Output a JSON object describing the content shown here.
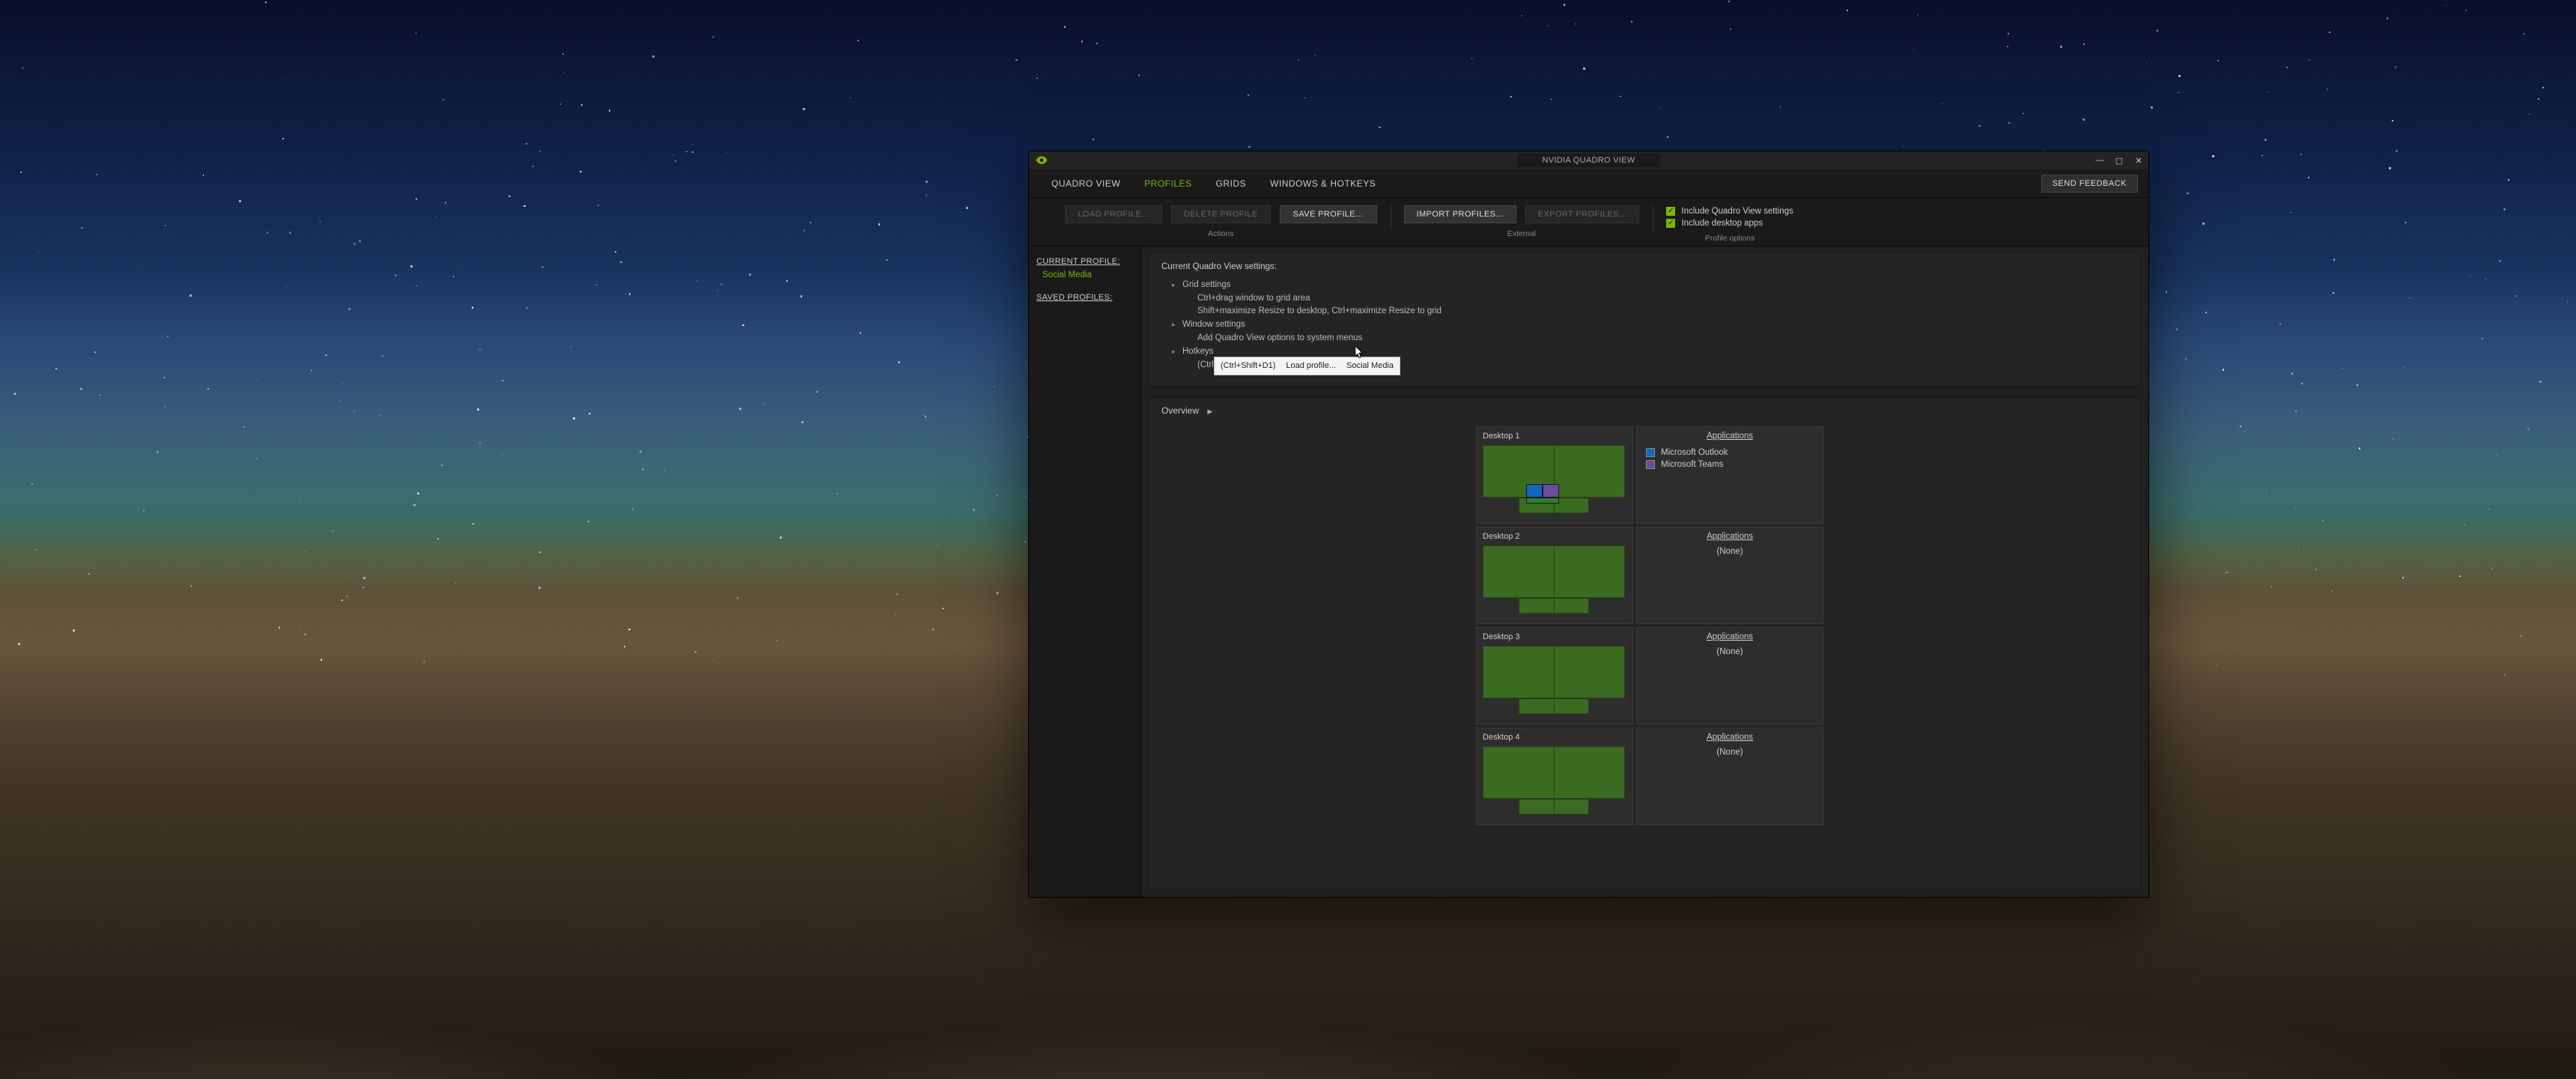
{
  "window": {
    "title": "NVIDIA QUADRO VIEW"
  },
  "menubar": {
    "items": [
      "QUADRO VIEW",
      "PROFILES",
      "GRIDS",
      "WINDOWS & HOTKEYS"
    ],
    "active_index": 1,
    "send_feedback": "SEND FEEDBACK"
  },
  "toolbar": {
    "actions": {
      "load": "LOAD PROFILE...",
      "delete": "DELETE PROFILE",
      "save": "SAVE PROFILE...",
      "caption": "Actions"
    },
    "external": {
      "import": "IMPORT PROFILES...",
      "export": "EXPORT PROFILES...",
      "caption": "External"
    },
    "options": {
      "include_qv": "Include Quadro View settings",
      "include_apps": "Include desktop apps",
      "caption": "Profile options"
    }
  },
  "sidebar": {
    "current_hdr": "CURRENT PROFILE:",
    "current_val": "Social Media",
    "saved_hdr": "SAVED PROFILES:"
  },
  "settings": {
    "title": "Current Quadro View settings:",
    "grid_hdr": "Grid settings",
    "grid_l1": "Ctrl+drag window to grid area",
    "grid_l2": "Shift+maximize Resize to desktop, Ctrl+maximize Resize to grid",
    "win_hdr": "Window settings",
    "win_l1": "Add Quadro View options to system menus",
    "hk_hdr": "Hotkeys",
    "hk_key": "(Ctrl+Shift+D1)",
    "hk_action": "Load profile...",
    "hk_target": "Social Media",
    "tooltip_key": "(Ctrl+Shift+D1)",
    "tooltip_action": "Load profile...",
    "tooltip_target": "Social Media"
  },
  "overview": {
    "title": "Overview",
    "apps_hdr": "Applications",
    "none": "(None)",
    "desktops": [
      {
        "label": "Desktop 1",
        "apps": [
          "Microsoft Outlook",
          "Microsoft Teams"
        ]
      },
      {
        "label": "Desktop 2",
        "apps": []
      },
      {
        "label": "Desktop 3",
        "apps": []
      },
      {
        "label": "Desktop 4",
        "apps": []
      }
    ]
  }
}
